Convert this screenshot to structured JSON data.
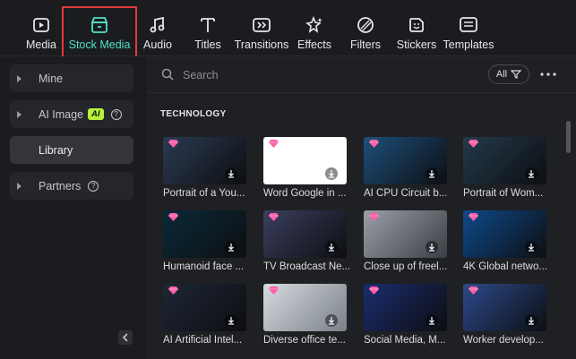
{
  "toolbar": {
    "items": [
      {
        "label": "Media",
        "icon": "media-icon"
      },
      {
        "label": "Stock Media",
        "icon": "stock-media-icon"
      },
      {
        "label": "Audio",
        "icon": "audio-icon"
      },
      {
        "label": "Titles",
        "icon": "titles-icon"
      },
      {
        "label": "Transitions",
        "icon": "transitions-icon"
      },
      {
        "label": "Effects",
        "icon": "effects-icon"
      },
      {
        "label": "Filters",
        "icon": "filters-icon"
      },
      {
        "label": "Stickers",
        "icon": "stickers-icon"
      },
      {
        "label": "Templates",
        "icon": "templates-icon"
      }
    ],
    "active": "Stock Media",
    "accent_color": "#4fe3c4",
    "highlight_color": "#e03a3a"
  },
  "sidebar": {
    "items": [
      {
        "label": "Mine"
      },
      {
        "label": "AI Image",
        "badge": "AI"
      },
      {
        "label": "Library",
        "selected": true
      },
      {
        "label": "Partners"
      }
    ]
  },
  "search": {
    "placeholder": "Search",
    "filter_label": "All"
  },
  "section": {
    "title": "TECHNOLOGY"
  },
  "cards": [
    {
      "caption": "Portrait of a You...",
      "bg": "#2b3b52"
    },
    {
      "caption": "Word Google in ...",
      "bg": "#ffffff"
    },
    {
      "caption": "AI CPU Circuit b...",
      "bg": "#1d4f7a"
    },
    {
      "caption": "Portrait of Wom...",
      "bg": "#233a4b"
    },
    {
      "caption": "Humanoid face ...",
      "bg": "#0a2a38"
    },
    {
      "caption": "TV Broadcast Ne...",
      "bg": "#3b3f5e"
    },
    {
      "caption": "Close up of freel...",
      "bg": "#6b6f77"
    },
    {
      "caption": "4K Global netwo...",
      "bg": "#0f4a8a"
    },
    {
      "caption": "AI Artificial Intel...",
      "bg": "#1e2635"
    },
    {
      "caption": "Diverse office te...",
      "bg": "#c9cfd4"
    },
    {
      "caption": "Social Media, M...",
      "bg": "#1b2c6e"
    },
    {
      "caption": "Worker develop...",
      "bg": "#2c4a8a"
    }
  ]
}
